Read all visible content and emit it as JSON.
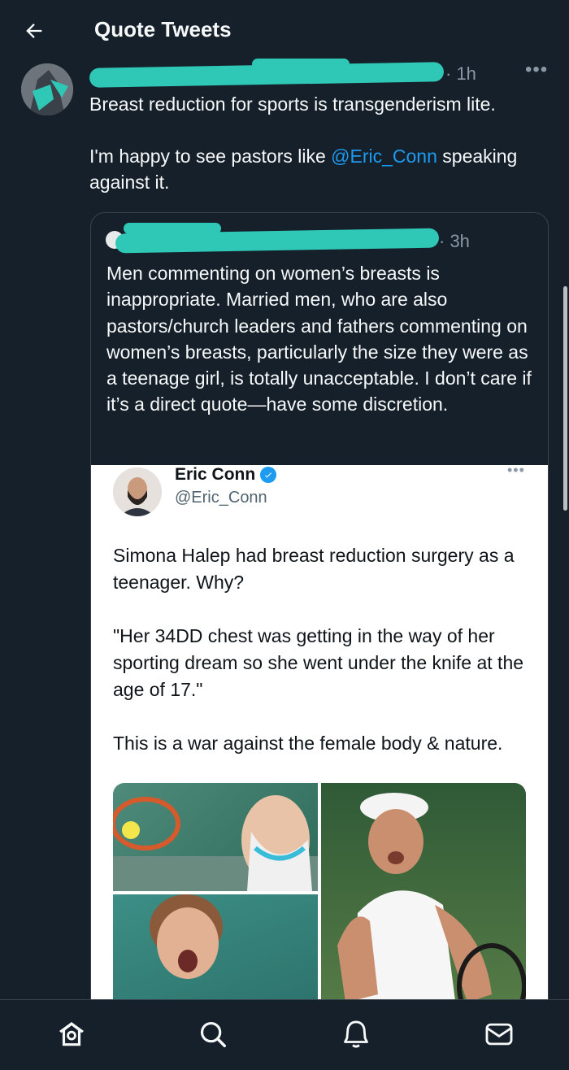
{
  "header": {
    "title": "Quote Tweets"
  },
  "tweet": {
    "time": "· 1h",
    "more": "•••",
    "text_before_mention": "Breast reduction for sports is transgenderism lite.\n\nI'm happy to see pastors like ",
    "mention": "@Eric_Conn",
    "text_after_mention": " speaking against it."
  },
  "quoted": {
    "time": "· 3h",
    "text": "Men commenting on women’s breasts is inappropriate. Married men, who are also pastors/church leaders and fathers commenting on women’s breasts, particularly the size they were as a teenage girl, is totally unacceptable. I don’t care if it’s a direct quote—have some discretion."
  },
  "embedded": {
    "name": "Eric Conn",
    "handle": "@Eric_Conn",
    "more": "•••",
    "text": "Simona Halep had breast reduction surgery as a teenager. Why?\n\n\"Her 34DD chest was getting in the way of her sporting dream so she went under the knife at the age of 17.\"\n\nThis is a war against the female body & nature."
  },
  "icons": {
    "back": "arrow-left-icon",
    "verified": "verified-badge-icon",
    "home": "home-icon",
    "search": "search-icon",
    "notifications": "bell-icon",
    "messages": "mail-icon"
  },
  "colors": {
    "background": "#15202b",
    "accent": "#1d9bf0",
    "redaction": "#2fc7b6",
    "border": "#38444d"
  }
}
